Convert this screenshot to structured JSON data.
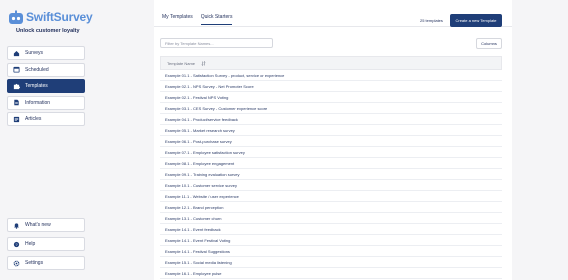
{
  "brand": {
    "title": "SwiftSurvey",
    "subtitle": "Unlock customer loyalty"
  },
  "sidebar": {
    "top_items": [
      {
        "label": "Surveys",
        "icon": "home-icon",
        "active": false
      },
      {
        "label": "Scheduled",
        "icon": "calendar-icon",
        "active": false
      },
      {
        "label": "Templates",
        "icon": "puzzle-icon",
        "active": true
      },
      {
        "label": "Information",
        "icon": "document-icon",
        "active": false
      },
      {
        "label": "Articles",
        "icon": "articles-icon",
        "active": false
      }
    ],
    "bottom_items": [
      {
        "label": "What's new",
        "icon": "bell-icon"
      },
      {
        "label": "Help",
        "icon": "help-icon"
      },
      {
        "label": "Settings",
        "icon": "gear-icon"
      }
    ]
  },
  "tabs": [
    {
      "label": "My Templates",
      "active": false
    },
    {
      "label": "Quick Starters",
      "active": true
    }
  ],
  "template_count": "25 templates",
  "create_button": "Create a new Template",
  "filter": {
    "placeholder": "Filter by Template Names..."
  },
  "columns_button": "Columns",
  "table": {
    "header": "Template Name",
    "rows": [
      "Example 01.1 - Satisfaction Survey - product, service or experience",
      "Example 02.1 - NPS Survey - Net Promoter Score",
      "Example 02.1 - Festival NPS Voting",
      "Example 03.1 - CES Survey - Customer experience score",
      "Example 04.1 - Product/service feedback",
      "Example 05.1 - Market research survey",
      "Example 06.1 - Post-purchase survey",
      "Example 07.1 - Employee satisfaction survey",
      "Example 08.1 - Employee engagement",
      "Example 09.1 - Training evaluation survey",
      "Example 10.1 - Customer service survey",
      "Example 11.1 - Website / user experience",
      "Example 12.1 - Brand perception",
      "Example 13.1 - Customer churn",
      "Example 14.1 - Event feedback",
      "Example 14.1 - Event Festival Voting",
      "Example 14.1 - Festival Suggestions",
      "Example 15.1 - Social media listening",
      "Example 16.1 - Employee pulse"
    ]
  },
  "colors": {
    "primary": "#1f3e78",
    "brand_blue": "#5a8fd8"
  }
}
